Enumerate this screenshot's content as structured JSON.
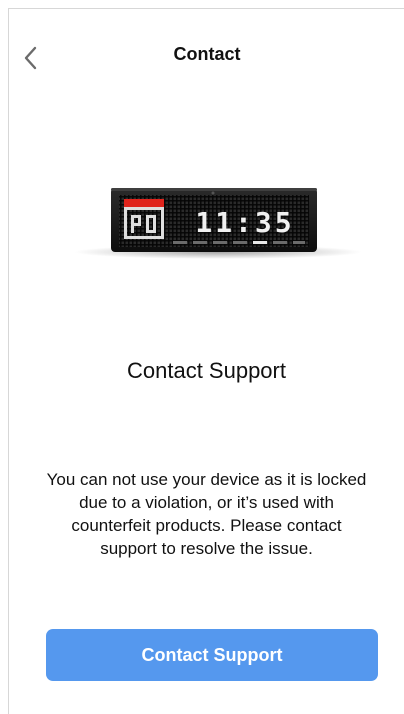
{
  "header": {
    "title": "Contact",
    "back_icon": "chevron-left-icon"
  },
  "device_display": {
    "time": "11:35"
  },
  "main": {
    "heading": "Contact Support",
    "message": "You can not use your device as it is locked due to a violation, or it’s used with counterfeit products. Please contact support to resolve the issue.",
    "button_label": "Contact Support"
  },
  "colors": {
    "accent": "#5598ee",
    "icon_red": "#e0241c"
  }
}
